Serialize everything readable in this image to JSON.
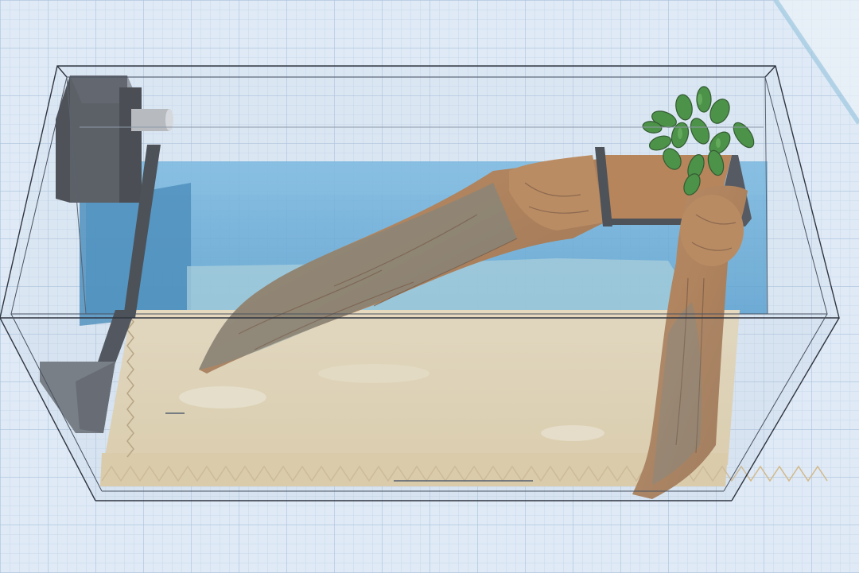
{
  "view": {
    "name": "3d-workplane-view",
    "object": "aquarium-tank-model"
  },
  "colors": {
    "grid_background": "#dfeaf6",
    "grid_minor": "#c7d8ea",
    "grid_major": "#a9c1db",
    "water": "#5aa6d6",
    "sand": "#e8d6b2",
    "wood": "#b07a4e",
    "filter": "#4c4f55",
    "plant": "#3f8a36",
    "glass_edge": "#2f3540"
  }
}
